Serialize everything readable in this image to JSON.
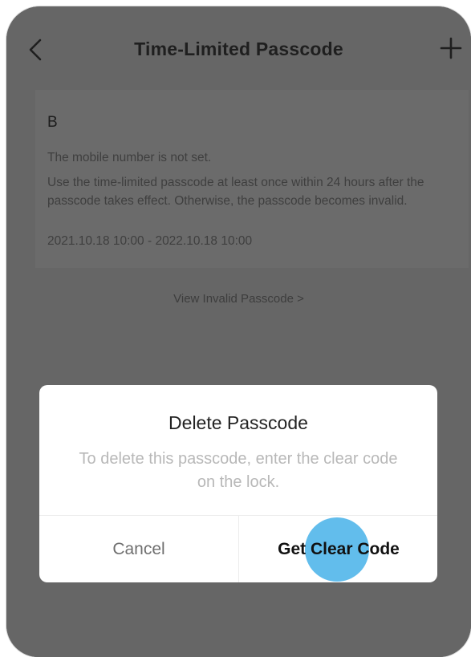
{
  "header": {
    "title": "Time-Limited Passcode",
    "back_icon": "chevron-left-icon",
    "add_icon": "plus-icon"
  },
  "passcode_card": {
    "name": "B",
    "mobile_status": "The mobile number is not set.",
    "usage_note": "Use the time-limited passcode at least once within 24 hours after the passcode takes effect. Otherwise, the passcode becomes invalid.",
    "validity_period": "2021.10.18 10:00 - 2022.10.18 10:00"
  },
  "view_invalid_link": "View Invalid Passcode >",
  "dialog": {
    "title": "Delete Passcode",
    "message": "To delete this passcode, enter the clear code on the lock.",
    "cancel_label": "Cancel",
    "confirm_label": "Get Clear Code"
  },
  "colors": {
    "overlay_dim": "#666666",
    "dialog_bg": "#ffffff",
    "touch_indicator": "#46b2e9"
  }
}
